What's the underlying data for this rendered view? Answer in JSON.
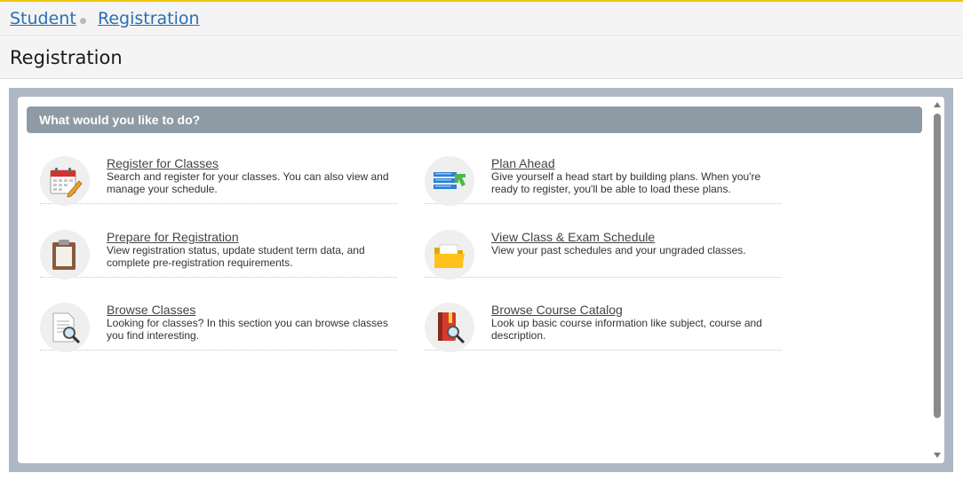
{
  "breadcrumb": {
    "first": "Student",
    "second": "Registration"
  },
  "page": {
    "title": "Registration"
  },
  "panel": {
    "heading": "What would you like to do?"
  },
  "items": [
    {
      "title": "Register for Classes",
      "desc": "Search and register for your classes. You can also view and manage your schedule.",
      "icon": "calendar-pencil-icon"
    },
    {
      "title": "Plan Ahead",
      "desc": "Give yourself a head start by building plans. When you're ready to register, you'll be able to load these plans.",
      "icon": "plan-list-icon"
    },
    {
      "title": "Prepare for Registration",
      "desc": "View registration status, update student term data, and complete pre-registration requirements.",
      "icon": "clipboard-icon"
    },
    {
      "title": "View Class & Exam Schedule",
      "desc": "View your past schedules and your ungraded classes.",
      "icon": "folder-icon"
    },
    {
      "title": "Browse Classes",
      "desc": "Looking for classes? In this section you can browse classes you find interesting.",
      "icon": "document-search-icon"
    },
    {
      "title": "Browse Course Catalog",
      "desc": "Look up basic course information like subject, course and description.",
      "icon": "book-search-icon"
    }
  ],
  "colors": {
    "accent_top": "#f2c500",
    "link": "#2a6fb6",
    "header_bar": "#8f9ba4",
    "frame": "#adb8c4"
  }
}
